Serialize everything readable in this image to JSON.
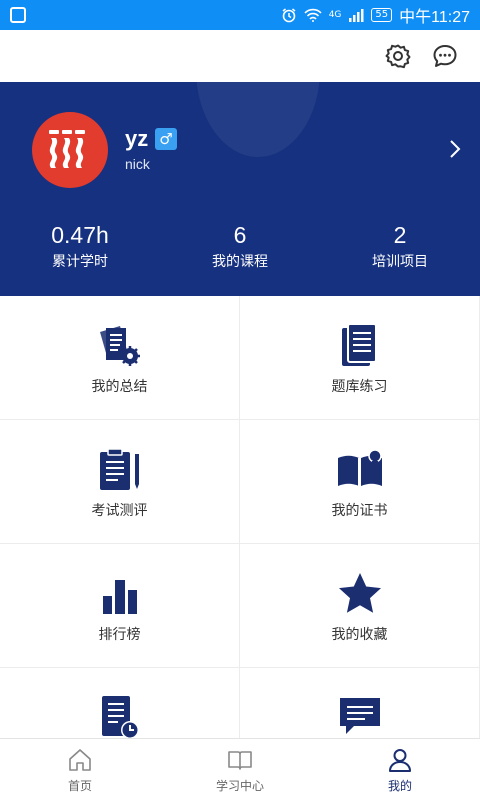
{
  "status_bar": {
    "signal_label": "4G",
    "battery": "55",
    "time": "中午11:27"
  },
  "toolbar": {
    "icons": [
      "gear-icon",
      "chat-bubble-icon"
    ]
  },
  "profile": {
    "username": "yz",
    "gender_symbol": "♂",
    "nickname": "nick",
    "colors": {
      "background": "#16317f",
      "avatar": "#e23c2e",
      "gender_badge": "#3aa0f2"
    },
    "stats": [
      {
        "value": "0.47h",
        "label": "累计学时"
      },
      {
        "value": "6",
        "label": "我的课程"
      },
      {
        "value": "2",
        "label": "培训项目"
      }
    ]
  },
  "menu": [
    {
      "label": "我的总结",
      "icon": "summary-docs-icon"
    },
    {
      "label": "题库练习",
      "icon": "question-bank-icon"
    },
    {
      "label": "考试测评",
      "icon": "exam-clipboard-icon"
    },
    {
      "label": "我的证书",
      "icon": "certificate-book-icon"
    },
    {
      "label": "排行榜",
      "icon": "ranking-bars-icon"
    },
    {
      "label": "我的收藏",
      "icon": "star-icon"
    },
    {
      "label": "",
      "icon": "document-clock-icon"
    },
    {
      "label": "",
      "icon": "message-icon"
    }
  ],
  "bottom_nav": [
    {
      "label": "首页",
      "icon": "home-icon",
      "active": false
    },
    {
      "label": "学习中心",
      "icon": "book-icon",
      "active": false
    },
    {
      "label": "我的",
      "icon": "user-icon",
      "active": true
    }
  ],
  "colors": {
    "accent": "#1a2e70",
    "status_bar": "#0f8ff5"
  }
}
